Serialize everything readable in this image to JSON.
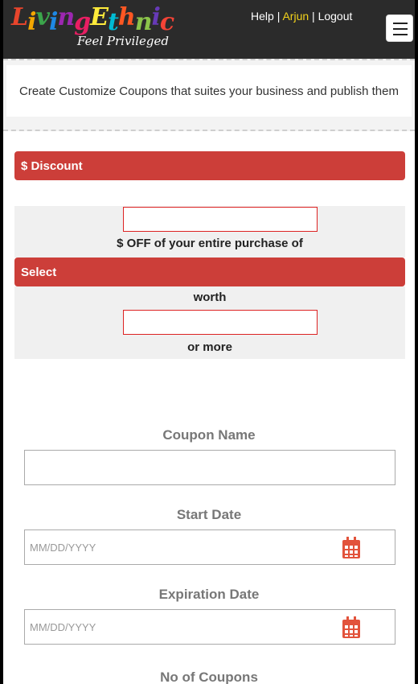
{
  "header": {
    "logo_text": "LivingEthnic",
    "logo_tagline": "Feel Privileged",
    "links": {
      "help": "Help",
      "separator": "|",
      "user": "Arjun",
      "logout": "Logout"
    }
  },
  "banner": {
    "text": "Create Customize Coupons that suites your business and publish them"
  },
  "discount": {
    "header": "$ Discount",
    "amount_value": "",
    "off_text": "$ OFF of your entire purchase of",
    "select_label": "Select",
    "worth_text": "worth",
    "worth_value": "",
    "or_more_text": "or more"
  },
  "form": {
    "coupon_name": {
      "label": "Coupon Name",
      "value": ""
    },
    "start_date": {
      "label": "Start Date",
      "placeholder": "MM/DD/YYYY"
    },
    "expiration_date": {
      "label": "Expiration Date",
      "placeholder": "MM/DD/YYYY"
    },
    "no_of_coupons": {
      "label": "No of Coupons"
    }
  },
  "colors": {
    "accent_red": "#cc3e39",
    "topbar": "#2b2b2b",
    "user_link": "#f2d21b",
    "logo_letters": [
      "#e8452c",
      "#f4a700",
      "#3ba54b",
      "#1e88e5",
      "#9c27b0",
      "#e91e63",
      "#ffeb3b",
      "#00bcd4",
      "#ff5722",
      "#8bc34a",
      "#673ab7",
      "#f44336"
    ]
  },
  "icons": {
    "calendar": "calendar-icon",
    "menu": "hamburger-menu-icon"
  }
}
